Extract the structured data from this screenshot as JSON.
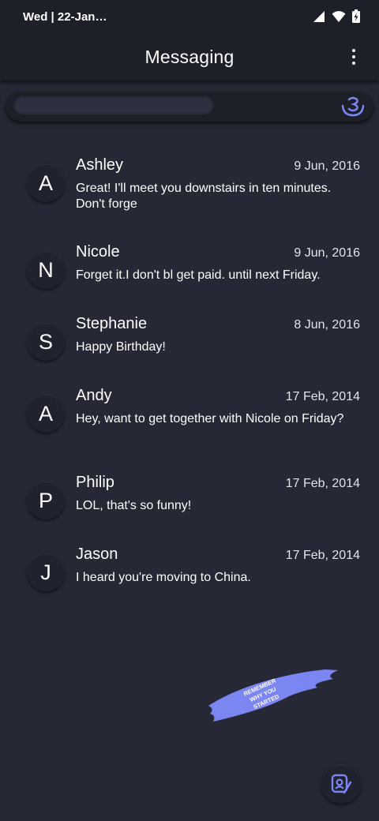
{
  "status_bar": {
    "time_text": "Wed | 22-Jan…",
    "icons": [
      "signal-icon",
      "wifi-icon",
      "battery-icon"
    ]
  },
  "app_bar": {
    "title": "Messaging",
    "menu_icon": "more-vert-icon"
  },
  "search": {
    "value": "",
    "placeholder": "",
    "mic_icon": "voice-search-icon"
  },
  "conversations": [
    {
      "initial": "A",
      "name": "Ashley",
      "date": "9 Jun, 2016",
      "snippet": "Great! I'll meet you downstairs in ten minutes. Don't forge"
    },
    {
      "initial": "N",
      "name": "Nicole",
      "date": "9 Jun, 2016",
      "snippet": "Forget it.I don't bl get paid. until next Friday."
    },
    {
      "initial": "S",
      "name": "Stephanie",
      "date": "8 Jun, 2016",
      "snippet": "Happy Birthday!"
    },
    {
      "initial": "A",
      "name": "Andy",
      "date": "17 Feb, 2014",
      "snippet": "Hey, want to get together with Nicole on Friday?"
    },
    {
      "initial": "P",
      "name": "Philip",
      "date": "17 Feb, 2014",
      "snippet": "LOL, that's so funny!"
    },
    {
      "initial": "J",
      "name": "Jason",
      "date": "17 Feb, 2014",
      "snippet": "I heard you're moving to China."
    }
  ],
  "sticker": {
    "text_lines": [
      "REMEMBER",
      "WHY YOU",
      "STARTED"
    ]
  },
  "fab": {
    "icon": "compose-message-icon"
  },
  "colors": {
    "background": "#262836",
    "bar": "#1e2029",
    "accent": "#7b86f3"
  }
}
